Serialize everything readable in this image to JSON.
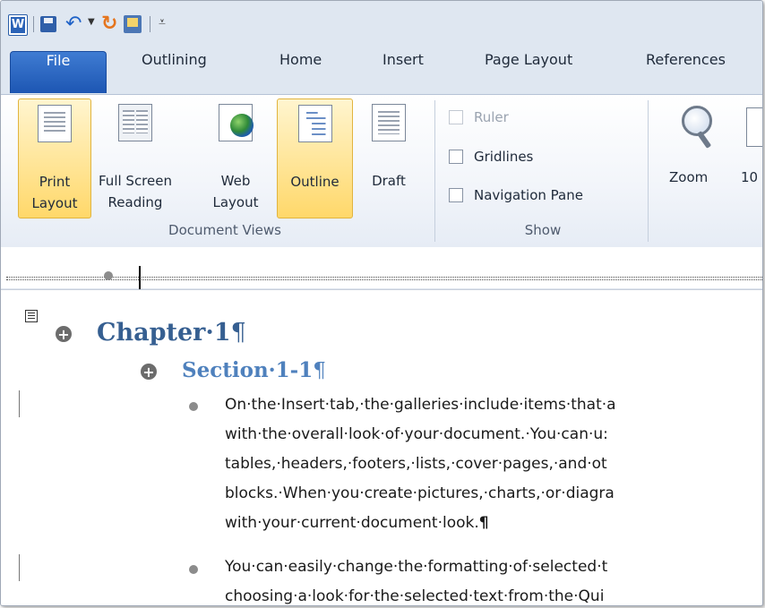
{
  "qat": {
    "app_icon": "word-logo-icon",
    "save_icon": "save-icon",
    "undo_icon": "undo-icon",
    "redo_icon": "redo-icon",
    "print_preview_icon": "print-preview-icon",
    "customize_icon": "customize-qat-icon"
  },
  "tabs": {
    "file": "File",
    "outlining": "Outlining",
    "home": "Home",
    "insert": "Insert",
    "page_layout": "Page Layout",
    "references": "References"
  },
  "ribbon": {
    "document_views": {
      "print_layout": [
        "Print",
        "Layout"
      ],
      "full_screen_reading": [
        "Full Screen",
        "Reading"
      ],
      "web_layout": [
        "Web",
        "Layout"
      ],
      "outline": "Outline",
      "draft": "Draft",
      "group_label": "Document Views"
    },
    "show": {
      "ruler": "Ruler",
      "gridlines": "Gridlines",
      "navigation_pane": "Navigation Pane",
      "group_label": "Show"
    },
    "zoom": {
      "zoom_label": "Zoom",
      "hundred_label": "10"
    }
  },
  "document": {
    "heading1": "Chapter·1",
    "heading2": "Section·1-1",
    "pilcrow": "¶",
    "paragraph1": [
      "On·the·Insert·tab,·the·galleries·include·items·that·a",
      "with·the·overall·look·of·your·document.·You·can·u:",
      "tables,·headers,·footers,·lists,·cover·pages,·and·ot",
      "blocks.·When·you·create·pictures,·charts,·or·diagra",
      "with·your·current·document·look."
    ],
    "paragraph2": [
      "You·can·easily·change·the·formatting·of·selected·t",
      "choosing·a·look·for·the·selected·text·from·the·Qui"
    ]
  },
  "colors": {
    "file_tab": "#1d56b3",
    "heading1": "#365f91",
    "heading2": "#4f81bd",
    "active_button": "#ffd86a"
  }
}
